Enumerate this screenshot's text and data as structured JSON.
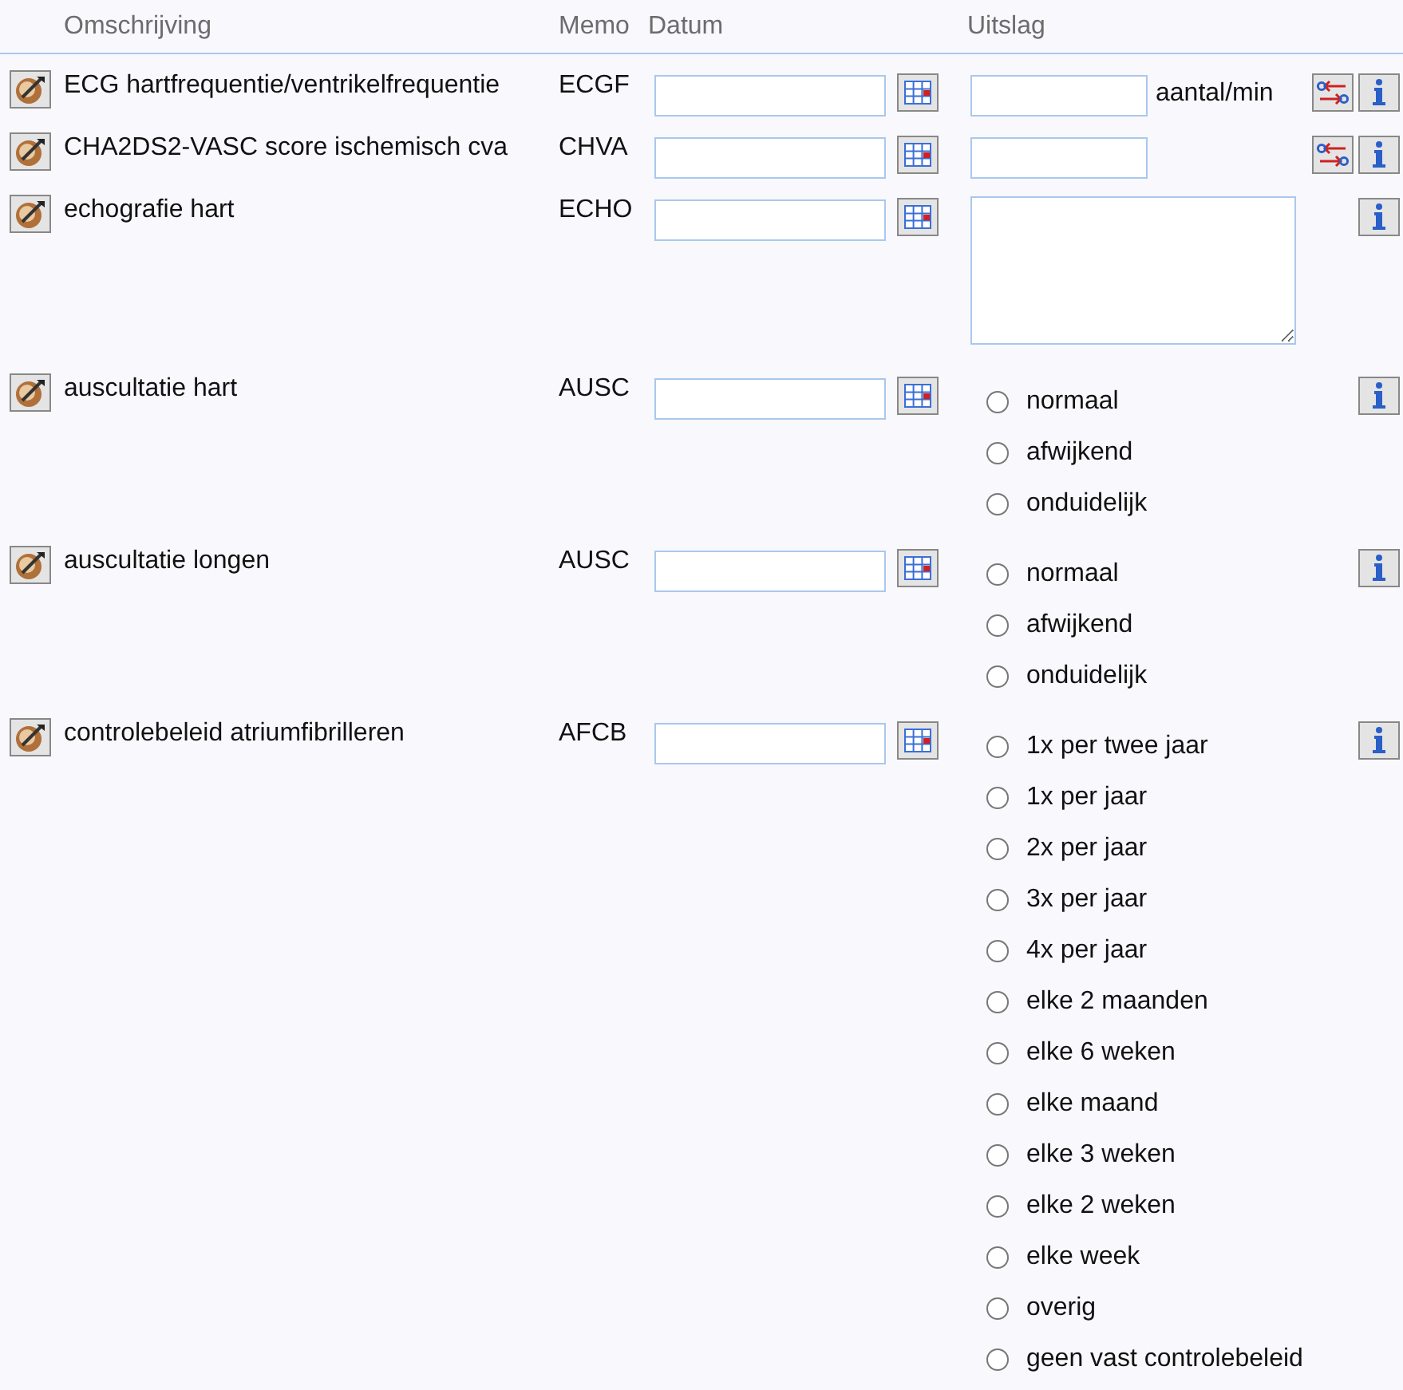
{
  "columns": [
    "Omschrijving",
    "Memo",
    "Datum",
    "Uitslag"
  ],
  "rows": [
    {
      "kind": "number",
      "description": "ECG hartfrequentie/ventrikelfrequentie",
      "memo": "ECGF",
      "unit": "aantal/min",
      "convert": true
    },
    {
      "kind": "number",
      "description": "CHA2DS2-VASC score ischemisch cva",
      "memo": "CHVA",
      "convert": true
    },
    {
      "kind": "text",
      "description": "echografie hart",
      "memo": "ECHO"
    },
    {
      "kind": "radio",
      "description": "auscultatie hart",
      "memo": "AUSC",
      "options": [
        {
          "label": "normaal",
          "selected": false
        },
        {
          "label": "afwijkend",
          "selected": false
        },
        {
          "label": "onduidelijk",
          "selected": false
        }
      ]
    },
    {
      "kind": "radio",
      "description": "auscultatie longen",
      "memo": "AUSC",
      "options": [
        {
          "label": "normaal",
          "selected": false
        },
        {
          "label": "afwijkend",
          "selected": false
        },
        {
          "label": "onduidelijk",
          "selected": false
        }
      ]
    },
    {
      "kind": "radio",
      "description": "controlebeleid atriumfibrilleren",
      "memo": "AFCB",
      "options": [
        {
          "label": "1x per twee jaar",
          "selected": false
        },
        {
          "label": "1x per jaar",
          "selected": false
        },
        {
          "label": "2x per jaar",
          "selected": false
        },
        {
          "label": "3x per jaar",
          "selected": false
        },
        {
          "label": "4x per jaar",
          "selected": false
        },
        {
          "label": "elke 2 maanden",
          "selected": false
        },
        {
          "label": "elke 6 weken",
          "selected": false
        },
        {
          "label": "elke maand",
          "selected": false
        },
        {
          "label": "elke 3 weken",
          "selected": false
        },
        {
          "label": "elke 2 weken",
          "selected": false
        },
        {
          "label": "elke week",
          "selected": false
        },
        {
          "label": "overig",
          "selected": false
        },
        {
          "label": "geen vast controlebeleid",
          "selected": false
        }
      ]
    }
  ]
}
